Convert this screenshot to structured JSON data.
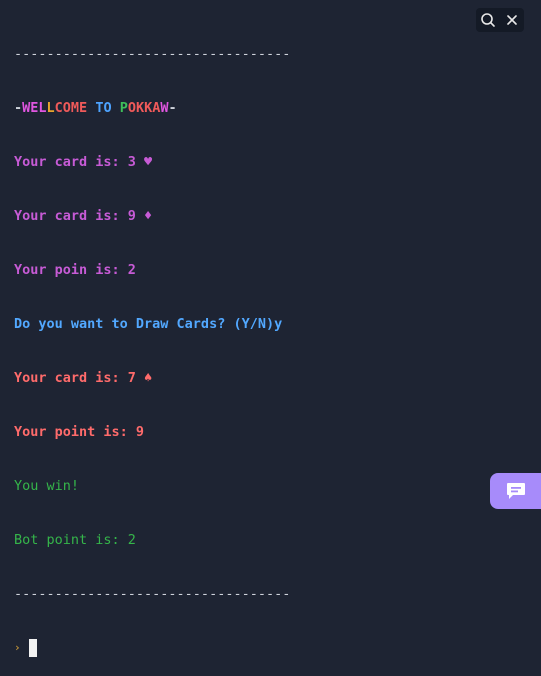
{
  "console": {
    "separator_top": "----------------------------------",
    "title_prefix": "-",
    "title_parts": [
      "WEL",
      "L",
      "COME",
      " ",
      "TO",
      " ",
      "P",
      "OKKA",
      "W"
    ],
    "title_suffix": "-",
    "lines": [
      {
        "text": "Your card is: 3 ♥",
        "color": "purple"
      },
      {
        "text": "Your card is: 9 ♦",
        "color": "purple"
      },
      {
        "text": "Your poin is: 2",
        "color": "purple"
      },
      {
        "text": "Do you want to Draw Cards? (Y/N)y",
        "color": "blue"
      },
      {
        "text": "Your card is: 7 ♠",
        "color": "red"
      },
      {
        "text": "Your point is: 9",
        "color": "red"
      },
      {
        "text": "You win!",
        "color": "green"
      },
      {
        "text": "Bot point is: 2",
        "color": "green"
      }
    ],
    "separator_bottom": "----------------------------------",
    "prompt_symbol": "›"
  },
  "toolbar": {
    "search_icon": "search-icon",
    "close_icon": "close-icon"
  },
  "chat_button": {
    "icon": "chat-icon",
    "color": "#a78bfa"
  }
}
